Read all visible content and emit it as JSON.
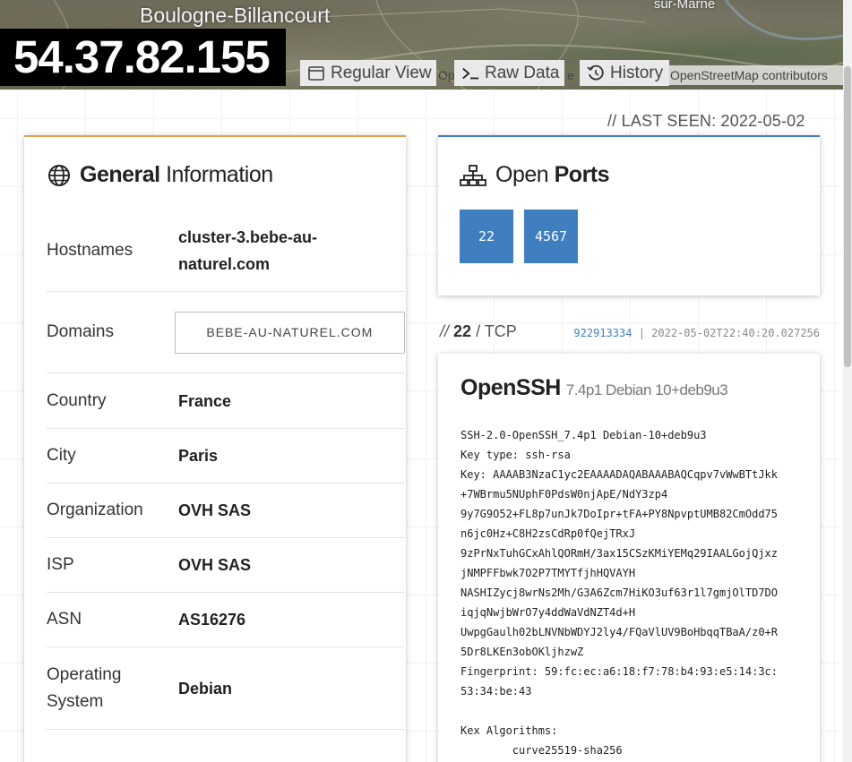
{
  "map": {
    "place_main": "Boulogne-Billancourt",
    "place_right": "Le Perreux-sur-Marne",
    "place_right_visible": "sur-Marne",
    "attribution": "OpenStreetMap contributors",
    "attribution_partial_a": "Op",
    "attribution_partial_b": "e"
  },
  "header": {
    "ip": "54.37.82.155",
    "tabs": {
      "regular": "Regular View",
      "raw": "Raw Data",
      "history": "History"
    }
  },
  "last_seen": "// LAST SEEN: 2022-05-02",
  "general": {
    "title_bold": "General",
    "title_light": "Information",
    "rows": {
      "hostnames": {
        "label": "Hostnames",
        "value_line1": "cluster-3.bebe-au-",
        "value_line2": "naturel.com"
      },
      "domains": {
        "label": "Domains",
        "value": "BEBE-AU-NATUREL.COM"
      },
      "country": {
        "label": "Country",
        "value": "France"
      },
      "city": {
        "label": "City",
        "value": "Paris"
      },
      "organization": {
        "label": "Organization",
        "value": "OVH SAS"
      },
      "isp": {
        "label": "ISP",
        "value": "OVH SAS"
      },
      "asn": {
        "label": "ASN",
        "value": "AS16276"
      },
      "os": {
        "label_line1": "Operating",
        "label_line2": "System",
        "value": "Debian"
      }
    }
  },
  "ports": {
    "title_light": "Open",
    "title_bold": "Ports",
    "items": [
      "22",
      "4567"
    ]
  },
  "service": {
    "meta_prefix": "//",
    "port": "22",
    "protocol": "/ TCP",
    "hash": "922913334",
    "separator": "|",
    "timestamp": "2022-05-02T22:40:20.027256",
    "name": "OpenSSH",
    "version": "7.4p1 Debian 10+deb9u3",
    "banner": [
      "SSH-2.0-OpenSSH_7.4p1 Debian-10+deb9u3",
      "Key type: ssh-rsa",
      "Key: AAAAB3NzaC1yc2EAAAADAQABAAABAQCqpv7vWwBTtJkk",
      "+7WBrmu5NUphF0PdsW0njApE/NdY3zp4",
      "9y7G9O52+FL8p7unJk7DoIpr+tFA+PY8NpvptUMB82CmOdd75",
      "n6jc0Hz+C8H2zsCdRp0fQejTRxJ",
      "9zPrNxTuhGCxAhlQORmH/3ax15CSzKMiYEMq29IAALGojQjxz",
      "jNMPFFbwk7O2P7TMYTfjhHQVAYH",
      "NASHIZycj8wrNs2Mh/G3A6Zcm7HiKO3uf63r1l7gmjOlTD7DO",
      "iqjqNwjbWrO7y4ddWaVdNZT4d+H",
      "UwpgGaulh02bLNVNbWDYJ2ly4/FQaVlUV9BoHbqqTBaA/z0+R",
      "5Dr8LKEn3obOKljhzwZ",
      "Fingerprint: 59:fc:ec:a6:18:f7:78:b4:93:e5:14:3c:",
      "53:34:be:43",
      "",
      "Kex Algorithms:",
      "        curve25519-sha256"
    ]
  }
}
